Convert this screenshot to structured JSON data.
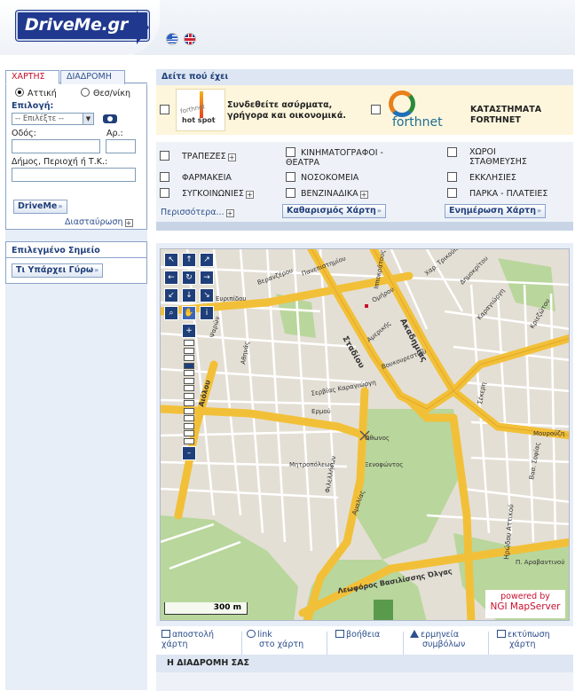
{
  "header": {
    "logo_text": "DriveMe.gr",
    "languages": [
      "greek-flag-icon",
      "uk-flag-icon"
    ]
  },
  "search": {
    "tabs": [
      {
        "label": "ΧΑΡΤΗΣ",
        "active": true
      },
      {
        "label": "ΔΙΑΔΡΟΜΗ",
        "active": false
      }
    ],
    "regions": [
      {
        "label": "Αττική",
        "selected": true
      },
      {
        "label": "Θεσ/νίκη",
        "selected": false
      }
    ],
    "choice_label": "Επιλογή:",
    "choice_value": "-- Επιλέξτε --",
    "street_label": "Οδός:",
    "number_label": "Αρ.:",
    "area_label": "Δήμος, Περιοχή ή Τ.Κ.:",
    "submit_label": "DriveMe",
    "crossing_label": "Διασταύρωση"
  },
  "selected_point": {
    "title": "Επιλεγμένο Σημείο",
    "button_label": "Τι Υπάρχει Γύρω"
  },
  "poi": {
    "title": "Δείτε πού έχει",
    "promos": [
      {
        "text": "Συνδεθείτε ασύρματα, γρήγορα και οικονομικά.",
        "logo_top": "forthnet",
        "logo_bottom": "hot spot"
      },
      {
        "text": "ΚΑΤΑΣΤΗΜΑΤΑ FORTHNET",
        "logo": "forthnet"
      }
    ],
    "categories": [
      {
        "label": "ΤΡΑΠΕΖΕΣ",
        "expandable": true
      },
      {
        "label": "ΚΙΝΗΜΑΤΟΓΡΑΦΟΙ - ΘΕΑΤΡΑ",
        "expandable": false
      },
      {
        "label": "ΧΩΡΟΙ ΣΤΑΘΜΕΥΣΗΣ",
        "expandable": false
      },
      {
        "label": "ΦΑΡΜΑΚΕΙΑ",
        "expandable": false
      },
      {
        "label": "ΝΟΣΟΚΟΜΕΙΑ",
        "expandable": false
      },
      {
        "label": "ΕΚΚΛΗΣΙΕΣ",
        "expandable": false
      },
      {
        "label": "ΣΥΓΚΟΙΝΩΝΙΕΣ",
        "expandable": true
      },
      {
        "label": "ΒΕΝΖΙΝΑΔΙΚΑ",
        "expandable": true
      },
      {
        "label": "ΠΑΡΚΑ - ΠΛΑΤΕΙΕΣ",
        "expandable": false
      }
    ],
    "more_label": "Περισσότερα...",
    "clear_label": "Καθαρισμός Χάρτη",
    "update_label": "Ενημέρωση Χάρτη"
  },
  "map": {
    "nav_icons": [
      "arrow-nw-icon",
      "arrow-n-icon",
      "arrow-ne-icon",
      "arrow-w-icon",
      "refresh-icon",
      "arrow-e-icon",
      "arrow-sw-icon",
      "arrow-s-icon",
      "arrow-se-icon",
      "zoom-box-icon",
      "pan-hand-icon",
      "info-icon"
    ],
    "zoom_in": "+",
    "zoom_out": "–",
    "zoom_levels": 14,
    "scale_label": "300 m",
    "powered_line1": "powered by",
    "powered_line2": "NGI MapServer",
    "streets": [
      "Ευριπίδου",
      "Σταδίου",
      "Ακαδημίας",
      "Ομήρου",
      "Αμερικής",
      "Βουκουρεστίου",
      "Σέκερη",
      "Σερβίας Καραγιώργη",
      "Ερμού",
      "Οθωνος",
      "Ξενοφώντος",
      "Μητροπόλεως",
      "Φιλελλήνων",
      "Αμαλίας",
      "Λεωφόρος Βασιλίσσης Όλγας",
      "Ηρώδου Αττικού",
      "Βασ. Σοφίας",
      "Μουρούζη",
      "Π. Αραβαντινού",
      "Κριεζώτου",
      "Καραγιώργη",
      "Αιόλου",
      "Αθηνάς",
      "Ψαρών",
      "Ιπποκράτους",
      "Βερανζέρου",
      "Χαρ. Τρικούπη",
      "Δημοκρίτου",
      "Πανεπιστημίου"
    ]
  },
  "tools": [
    {
      "icon": "mail-icon",
      "line1": "αποστολή",
      "line2": "χάρτη"
    },
    {
      "icon": "link-icon",
      "line1": "link",
      "line2": "στο χάρτη"
    },
    {
      "icon": "help-icon",
      "line1": "βοήθεια",
      "line2": ""
    },
    {
      "icon": "warning-icon",
      "line1": "ερμηνεία",
      "line2": "συμβόλων"
    },
    {
      "icon": "print-icon",
      "line1": "εκτύπωση",
      "line2": "χάρτη"
    }
  ],
  "route": {
    "title": "Η ΔΙΑΔΡΟΜΗ ΣΑΣ"
  },
  "colors": {
    "brand": "#20398f",
    "accent_red": "#c8102e",
    "road_yellow": "#f2c038",
    "park_green": "#b9d69c"
  }
}
